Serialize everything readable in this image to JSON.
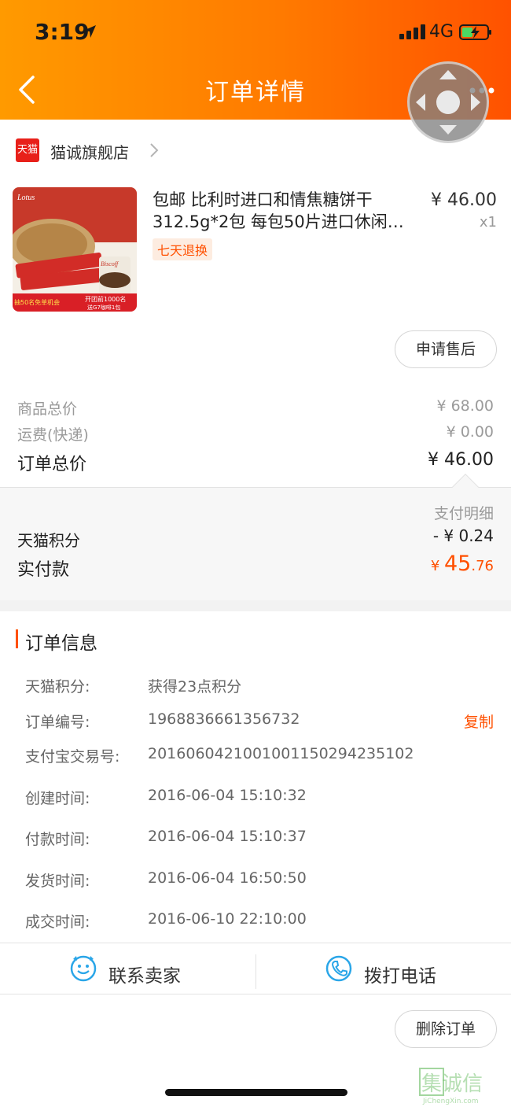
{
  "status_bar": {
    "time": "3:19",
    "network": "4G"
  },
  "header": {
    "title": "订单详情"
  },
  "shop": {
    "badge": "天猫",
    "name": "猫诚旗舰店"
  },
  "product": {
    "title": "包邮 比利时进口和情焦糖饼干312.5g*2包 每包50片进口休闲…",
    "price": "¥ 46.00",
    "quantity": "x1",
    "return_policy": "七天退换",
    "image_texts": {
      "brand": "Lotus",
      "biscoff": "Biscoff",
      "promo_left": "抽50名免单机会",
      "promo_right_1": "开团前1000名",
      "promo_right_2": "送G7咖啡1包"
    },
    "after_sale_label": "申请售后"
  },
  "summary": {
    "goods_total_label": "商品总价",
    "goods_total_value": "¥ 68.00",
    "shipping_label": "运费(快递)",
    "shipping_value": "¥ 0.00",
    "order_total_label": "订单总价",
    "order_total_value": "¥ 46.00"
  },
  "payment": {
    "detail_link": "支付明细",
    "points_label": "天猫积分",
    "points_value": "- ¥ 0.24",
    "paid_label": "实付款",
    "paid_currency": "¥ ",
    "paid_int": "45",
    "paid_dec": ".76",
    "accent_color": "#ff5000"
  },
  "order_info": {
    "section_title": "订单信息",
    "copy_label": "复制",
    "rows": [
      {
        "label": "天猫积分:",
        "value": "获得23点积分"
      },
      {
        "label": "订单编号:",
        "value": "1968836661356732"
      },
      {
        "label": "支付宝交易号:",
        "value": "2016060421001001150294235102"
      },
      {
        "label": "创建时间:",
        "value": "2016-06-04 15:10:32"
      },
      {
        "label": "付款时间:",
        "value": "2016-06-04 15:10:37"
      },
      {
        "label": "发货时间:",
        "value": "2016-06-04 16:50:50"
      },
      {
        "label": "成交时间:",
        "value": "2016-06-10 22:10:00"
      }
    ]
  },
  "contact": {
    "seller_label": "联系卖家",
    "phone_label": "拨打电话"
  },
  "actions": {
    "delete_label": "删除订单"
  },
  "watermark": {
    "text": "集诚信",
    "sub": "JiChengXin.com"
  }
}
